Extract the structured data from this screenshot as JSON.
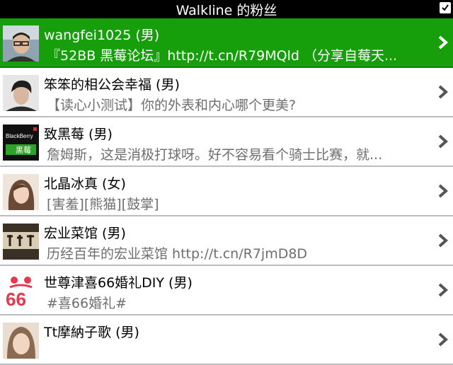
{
  "header": {
    "title": "Walkline 的粉丝"
  },
  "followers": [
    {
      "name": "wangfei1025 (男)",
      "status": "『52BB 黑莓论坛』http://t.cn/R79MQld （分享自莓天...",
      "avatar": "avatar-photo-man-glasses",
      "selected": true
    },
    {
      "name": "笨笨的相公会幸福 (男)",
      "status": "【读心小测试】你的外表和内心哪个更美?",
      "avatar": "avatar-photo-young-man",
      "selected": false
    },
    {
      "name": "致黑莓 (男)",
      "status": "詹姆斯，这是消极打球呀。好不容易看个骑士比赛，就...",
      "avatar": "blackberry-logo-icon",
      "selected": false,
      "avatar_text": [
        "BlackBerry",
        "黑莓"
      ]
    },
    {
      "name": "北晶冰真 (女)",
      "status": "[害羞][熊猫][鼓掌]",
      "avatar": "avatar-photo-woman",
      "selected": false
    },
    {
      "name": "宏业菜馆 (男)",
      "status": "历经百年的宏业菜馆 http://t.cn/R7jmD8D",
      "avatar": "avatar-photo-restaurant-sign",
      "selected": false
    },
    {
      "name": "世尊津喜66婚礼DIY (男)",
      "status": "#喜66婚礼#",
      "avatar": "wedding-66-logo-icon",
      "selected": false,
      "avatar_text": [
        "66"
      ]
    },
    {
      "name": "Tt摩納子歌 (男)",
      "status": "",
      "avatar": "avatar-photo-woman-2",
      "selected": false
    }
  ],
  "colors": {
    "selected_bg": "#169f0b",
    "status_text": "#6e6e6e",
    "divider": "#bdbdbd",
    "header_bg": "#000000"
  }
}
